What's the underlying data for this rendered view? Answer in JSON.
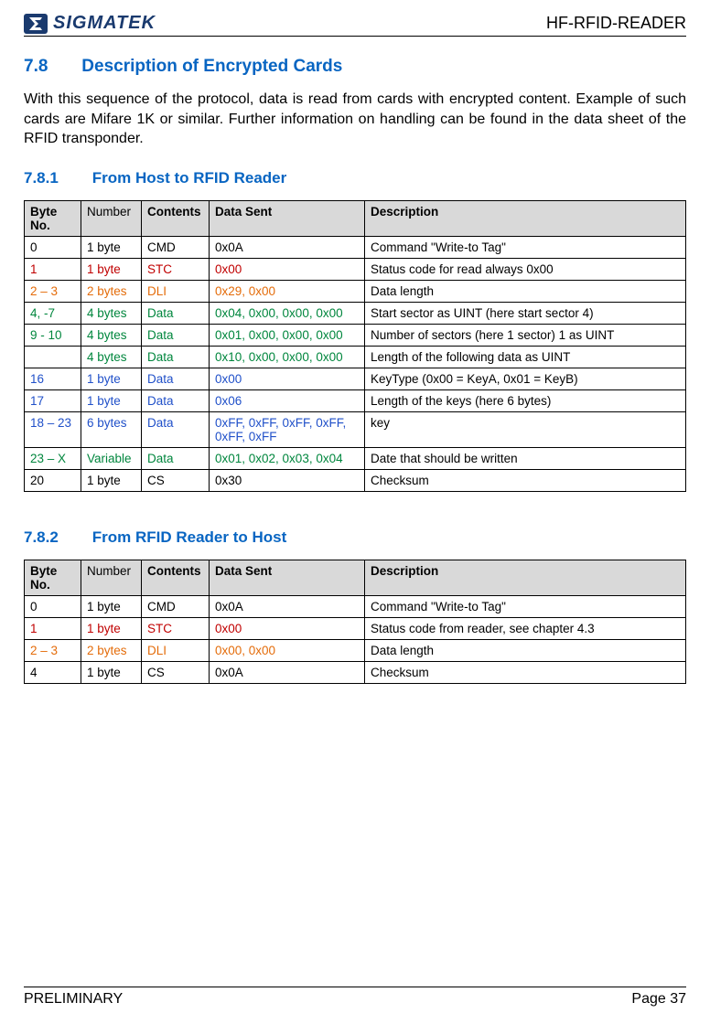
{
  "header": {
    "brand": "SIGMATEK",
    "doc_id": "HF-RFID-READER"
  },
  "section": {
    "num": "7.8",
    "title": "Description of Encrypted Cards",
    "intro": "With this sequence of the protocol, data is read from cards with encrypted content. Example of such cards are Mifare 1K or similar. Further information on handling can be found in the data sheet of the RFID transponder."
  },
  "sub1": {
    "num": "7.8.1",
    "title": "From Host to RFID Reader"
  },
  "table1": {
    "headers": {
      "byte": "Byte No.",
      "number": "Number",
      "contents": "Contents",
      "sent": "Data Sent",
      "desc": "Description"
    },
    "rows": [
      {
        "cls": "",
        "byte": "0",
        "number": "1 byte",
        "contents": "CMD",
        "sent": "0x0A",
        "desc": "Command \"Write-to Tag\""
      },
      {
        "cls": "row-red row-keep-desc",
        "byte": "1",
        "number": "1 byte",
        "contents": "STC",
        "sent": "0x00",
        "desc": "Status code for read always 0x00"
      },
      {
        "cls": "row-orange row-keep-desc",
        "byte": "2 – 3",
        "number": "2 bytes",
        "contents": "DLI",
        "sent": "0x29, 0x00",
        "desc": "Data length"
      },
      {
        "cls": "row-green row-keep-desc",
        "byte": "4, -7",
        "number": "4 bytes",
        "contents": "Data",
        "sent": "0x04, 0x00, 0x00, 0x00",
        "desc": "Start sector as UINT (here start sector 4)"
      },
      {
        "cls": "row-green row-keep-desc",
        "byte": "9 - 10",
        "number": "4 bytes",
        "contents": "Data",
        "sent": "0x01, 0x00, 0x00, 0x00",
        "desc": "Number of sectors (here 1 sector) 1 as UINT"
      },
      {
        "cls": "row-green row-keep-desc",
        "byte": "",
        "number": "4 bytes",
        "contents": "Data",
        "sent": "0x10, 0x00, 0x00, 0x00",
        "desc": "Length of the following data as UINT"
      },
      {
        "cls": "row-blue row-keep-desc",
        "byte": "16",
        "number": "1 byte",
        "contents": "Data",
        "sent": "0x00",
        "desc": "KeyType (0x00 = KeyA, 0x01 = KeyB)"
      },
      {
        "cls": "row-blue row-keep-desc",
        "byte": "17",
        "number": "1 byte",
        "contents": "Data",
        "sent": "0x06",
        "desc": "Length of the keys (here 6 bytes)"
      },
      {
        "cls": "row-blue row-keep-desc",
        "byte": "18 – 23",
        "number": "6 bytes",
        "contents": "Data",
        "sent": "0xFF, 0xFF, 0xFF, 0xFF, 0xFF, 0xFF",
        "desc": "key"
      },
      {
        "cls": "row-green row-keep-desc",
        "byte": "23 – X",
        "number": "Variable",
        "contents": "Data",
        "sent": "0x01, 0x02, 0x03, 0x04",
        "desc": "Date that should be written"
      },
      {
        "cls": "",
        "byte": "20",
        "number": "1 byte",
        "contents": "CS",
        "sent": "0x30",
        "desc": "Checksum"
      }
    ]
  },
  "sub2": {
    "num": "7.8.2",
    "title": "From RFID Reader to Host"
  },
  "table2": {
    "headers": {
      "byte": "Byte No.",
      "number": "Number",
      "contents": "Contents",
      "sent": "Data Sent",
      "desc": "Description"
    },
    "rows": [
      {
        "cls": "",
        "byte": "0",
        "number": "1 byte",
        "contents": "CMD",
        "sent": "0x0A",
        "desc": "Command \"Write-to Tag\""
      },
      {
        "cls": "row-red row-keep-desc",
        "byte": "1",
        "number": "1 byte",
        "contents": "STC",
        "sent": "0x00",
        "desc": "Status code from reader, see chapter 4.3"
      },
      {
        "cls": "row-orange row-keep-desc",
        "byte": "2 – 3",
        "number": "2 bytes",
        "contents": "DLI",
        "sent": "0x00, 0x00",
        "desc": "Data length"
      },
      {
        "cls": "",
        "byte": "4",
        "number": "1 byte",
        "contents": "CS",
        "sent": "0x0A",
        "desc": "Checksum"
      }
    ]
  },
  "footer": {
    "left": "PRELIMINARY",
    "right": "Page 37"
  }
}
